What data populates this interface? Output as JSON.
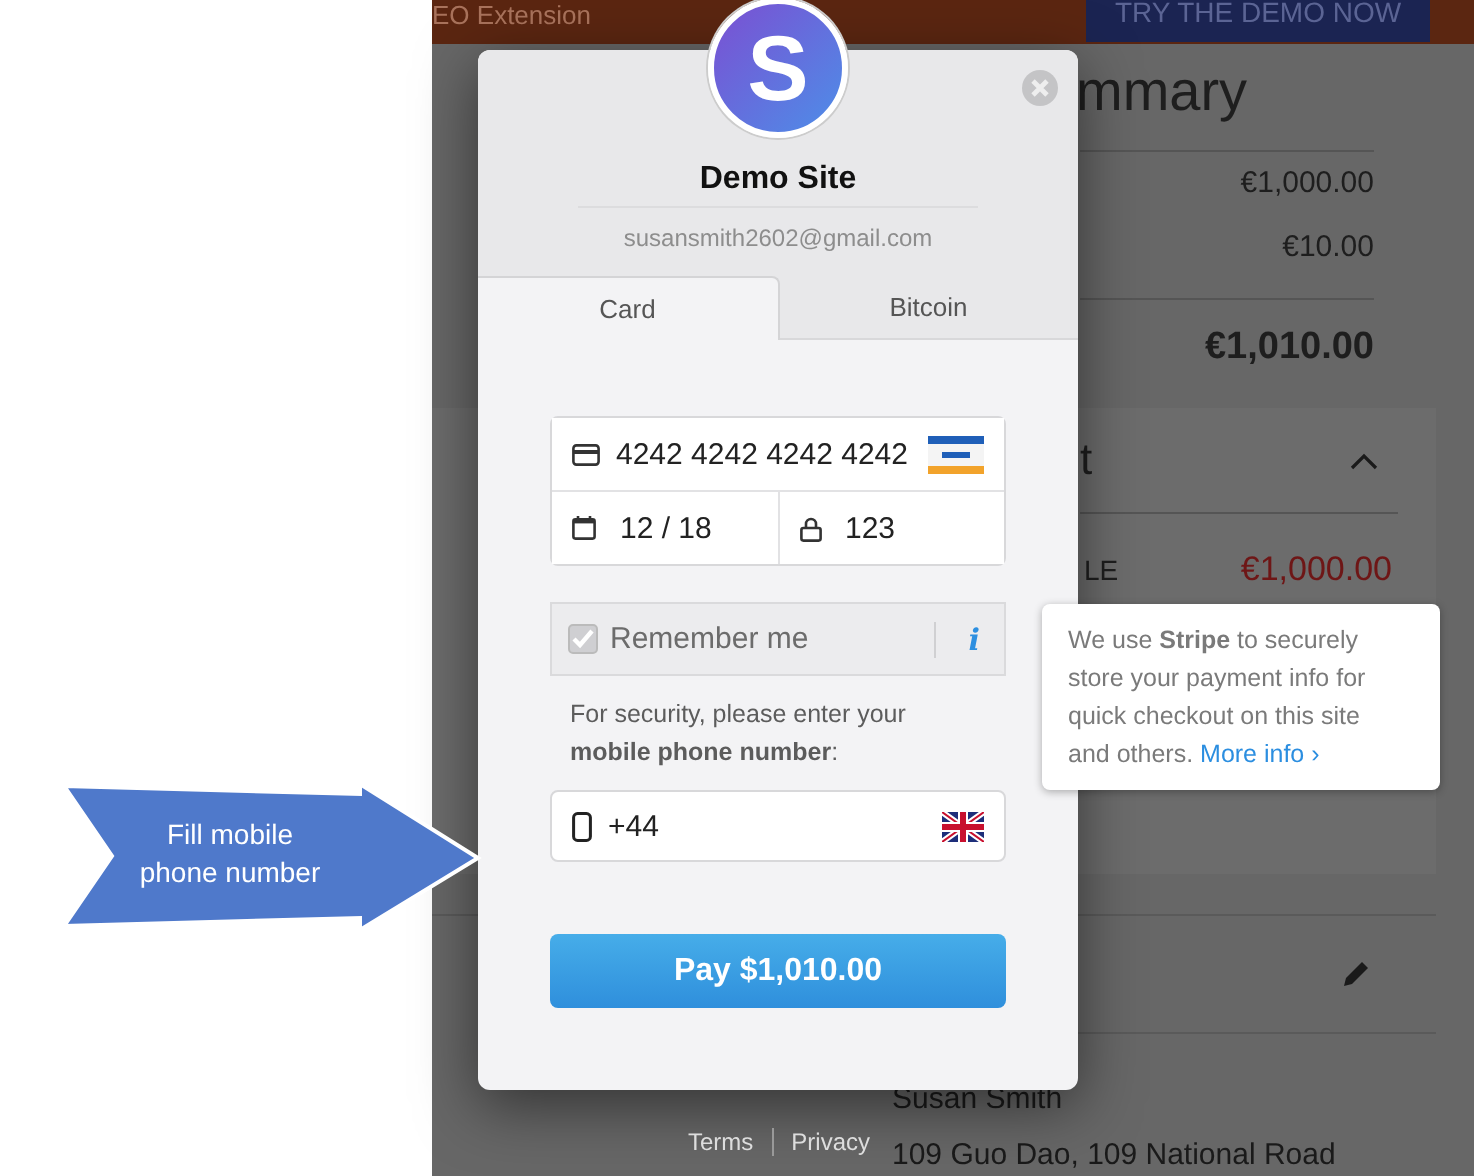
{
  "header": {
    "text": "EO Extension",
    "button": "TRY THE DEMO NOW"
  },
  "summary": {
    "title": "mmary",
    "rows": [
      "€1,000.00",
      "€10.00"
    ],
    "total": "€1,010.00"
  },
  "section": {
    "title": "t",
    "expanded": true,
    "item_label": "LE",
    "item_price": "€1,000.00"
  },
  "shipping": {
    "name": "Susan Smith",
    "address": "109 Guo Dao, 109 National Road"
  },
  "checkout": {
    "logo": "S",
    "title": "Demo Site",
    "email": "susansmith2602@gmail.com",
    "tabs": [
      {
        "label": "Card",
        "selected": true
      },
      {
        "label": "Bitcoin",
        "selected": false
      }
    ],
    "card_number": "4242 4242 4242 4242",
    "expiry": "12 / 18",
    "cvc": "123",
    "remember": {
      "label": "Remember me",
      "checked": true,
      "info": "i"
    },
    "security_note": "For security, please enter your **mobile phone number**:",
    "phone": "+44",
    "pay_button": "Pay $1,010.00"
  },
  "tooltip": {
    "text": "We use **Stripe** to securely store your payment info for quick checkout on this site and others.",
    "link": "More info ›"
  },
  "callout": "Fill mobile phone number",
  "footer_links": [
    "Terms",
    "Privacy"
  ]
}
